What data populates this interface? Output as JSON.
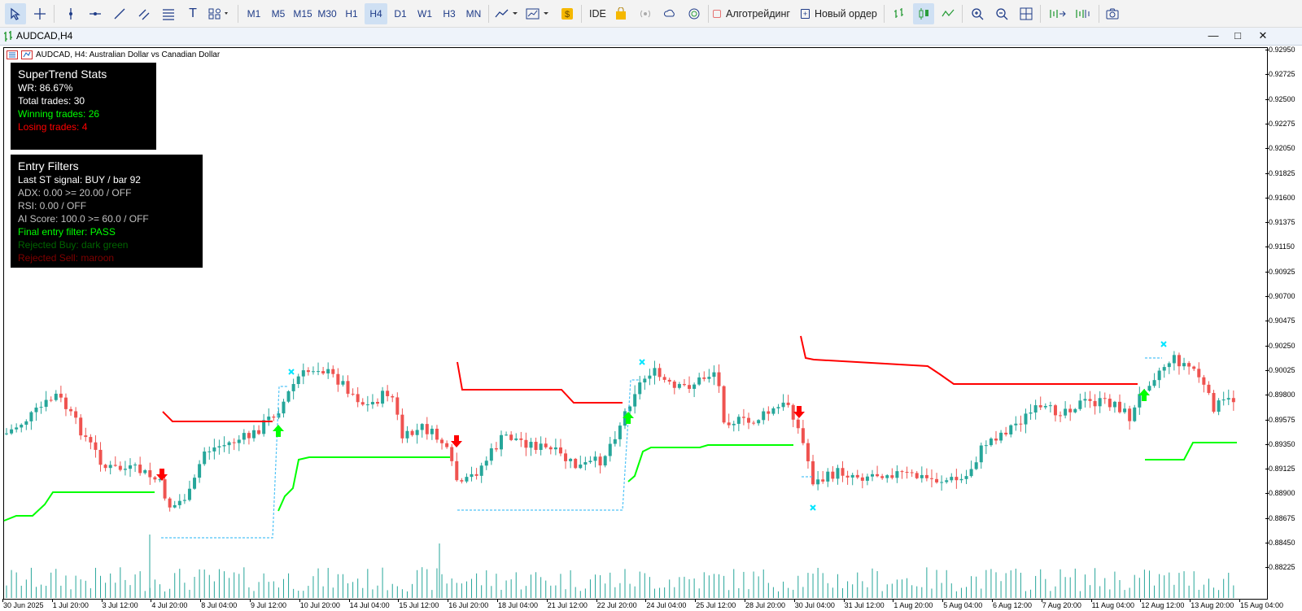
{
  "toolbar": {
    "timeframes": [
      "M1",
      "M5",
      "M15",
      "M30",
      "H1",
      "H4",
      "D1",
      "W1",
      "H3",
      "MN"
    ],
    "active_timeframe": "H4",
    "ide_label": "IDE",
    "algo_label": "Алготрейдинг",
    "new_order_label": "Новый ордер"
  },
  "window": {
    "title": "AUDCAD,H4"
  },
  "chart": {
    "header": "AUDCAD, H4:  Australian Dollar vs Canadian Dollar",
    "price_labels": [
      "0.92950",
      "0.92725",
      "0.92500",
      "0.92275",
      "0.92050",
      "0.91825",
      "0.91600",
      "0.91375",
      "0.91150",
      "0.90925",
      "0.90700",
      "0.90475",
      "0.90250",
      "0.90025",
      "0.89800",
      "0.89575",
      "0.89350",
      "0.89125",
      "0.88900",
      "0.88675",
      "0.88450",
      "0.88225"
    ],
    "time_labels": [
      "30 Jun 2025",
      "1 Jul 20:00",
      "3 Jul 12:00",
      "4 Jul 20:00",
      "8 Jul 04:00",
      "9 Jul 12:00",
      "10 Jul 20:00",
      "14 Jul 04:00",
      "15 Jul 12:00",
      "16 Jul 20:00",
      "18 Jul 04:00",
      "21 Jul 12:00",
      "22 Jul 20:00",
      "24 Jul 04:00",
      "25 Jul 12:00",
      "28 Jul 20:00",
      "30 Jul 04:00",
      "31 Jul 12:00",
      "1 Aug 20:00",
      "5 Aug 04:00",
      "6 Aug 12:00",
      "7 Aug 20:00",
      "11 Aug 04:00",
      "12 Aug 12:00",
      "13 Aug 20:00",
      "15 Aug 04:00"
    ]
  },
  "stats_panel": {
    "title": "SuperTrend Stats",
    "wr": "WR: 86.67%",
    "total": "Total trades: 30",
    "winning": "Winning trades: 26",
    "losing": "Losing trades: 4"
  },
  "filters_panel": {
    "title": "Entry Filters",
    "last_signal": "Last ST signal: BUY / bar 92",
    "adx": "ADX: 0.00 >= 20.00 / OFF",
    "rsi": "RSI: 0.00 / OFF",
    "ai": "AI Score: 100.0 >= 60.0 / OFF",
    "final": "Final entry filter: PASS",
    "rej_buy": "Rejected Buy: dark green",
    "rej_sell": "Rejected Sell: maroon"
  },
  "colors": {
    "bull": "#26a69a",
    "bear": "#ef5350",
    "supertrend_up": "#00ff00",
    "supertrend_down": "#ff0000",
    "dotted": "#4fc3f7",
    "panel_bg": "#000000",
    "win": "#00ff00",
    "lose": "#ff0000",
    "dim": "#c0c0c0",
    "rej_buy": "#006400",
    "rej_sell": "#800000"
  }
}
